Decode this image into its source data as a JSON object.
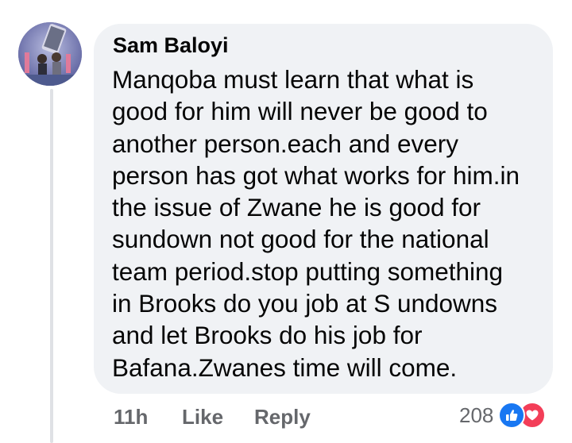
{
  "comment": {
    "author": "Sam Baloyi",
    "lines": [
      "Manqoba must learn that what is",
      "good for him will never be good to",
      "another person.each and every",
      "person has got what works for him.in",
      "the issue of Zwane he is good for",
      "sundown not good for the national",
      "team period.stop putting something",
      "in Brooks do you job at S undowns",
      "and let Brooks do his job for",
      "Bafana.Zwanes time will come."
    ]
  },
  "actions": {
    "time": "11h",
    "like_label": "Like",
    "reply_label": "Reply"
  },
  "reactions": {
    "count": "208",
    "icons": [
      "thumbs-up-icon",
      "heart-icon"
    ],
    "like_color": "#1877f2",
    "love_color": "#f33e58"
  },
  "colors": {
    "bubble": "#f0f2f5",
    "text": "#050505",
    "secondary": "#65676b"
  }
}
